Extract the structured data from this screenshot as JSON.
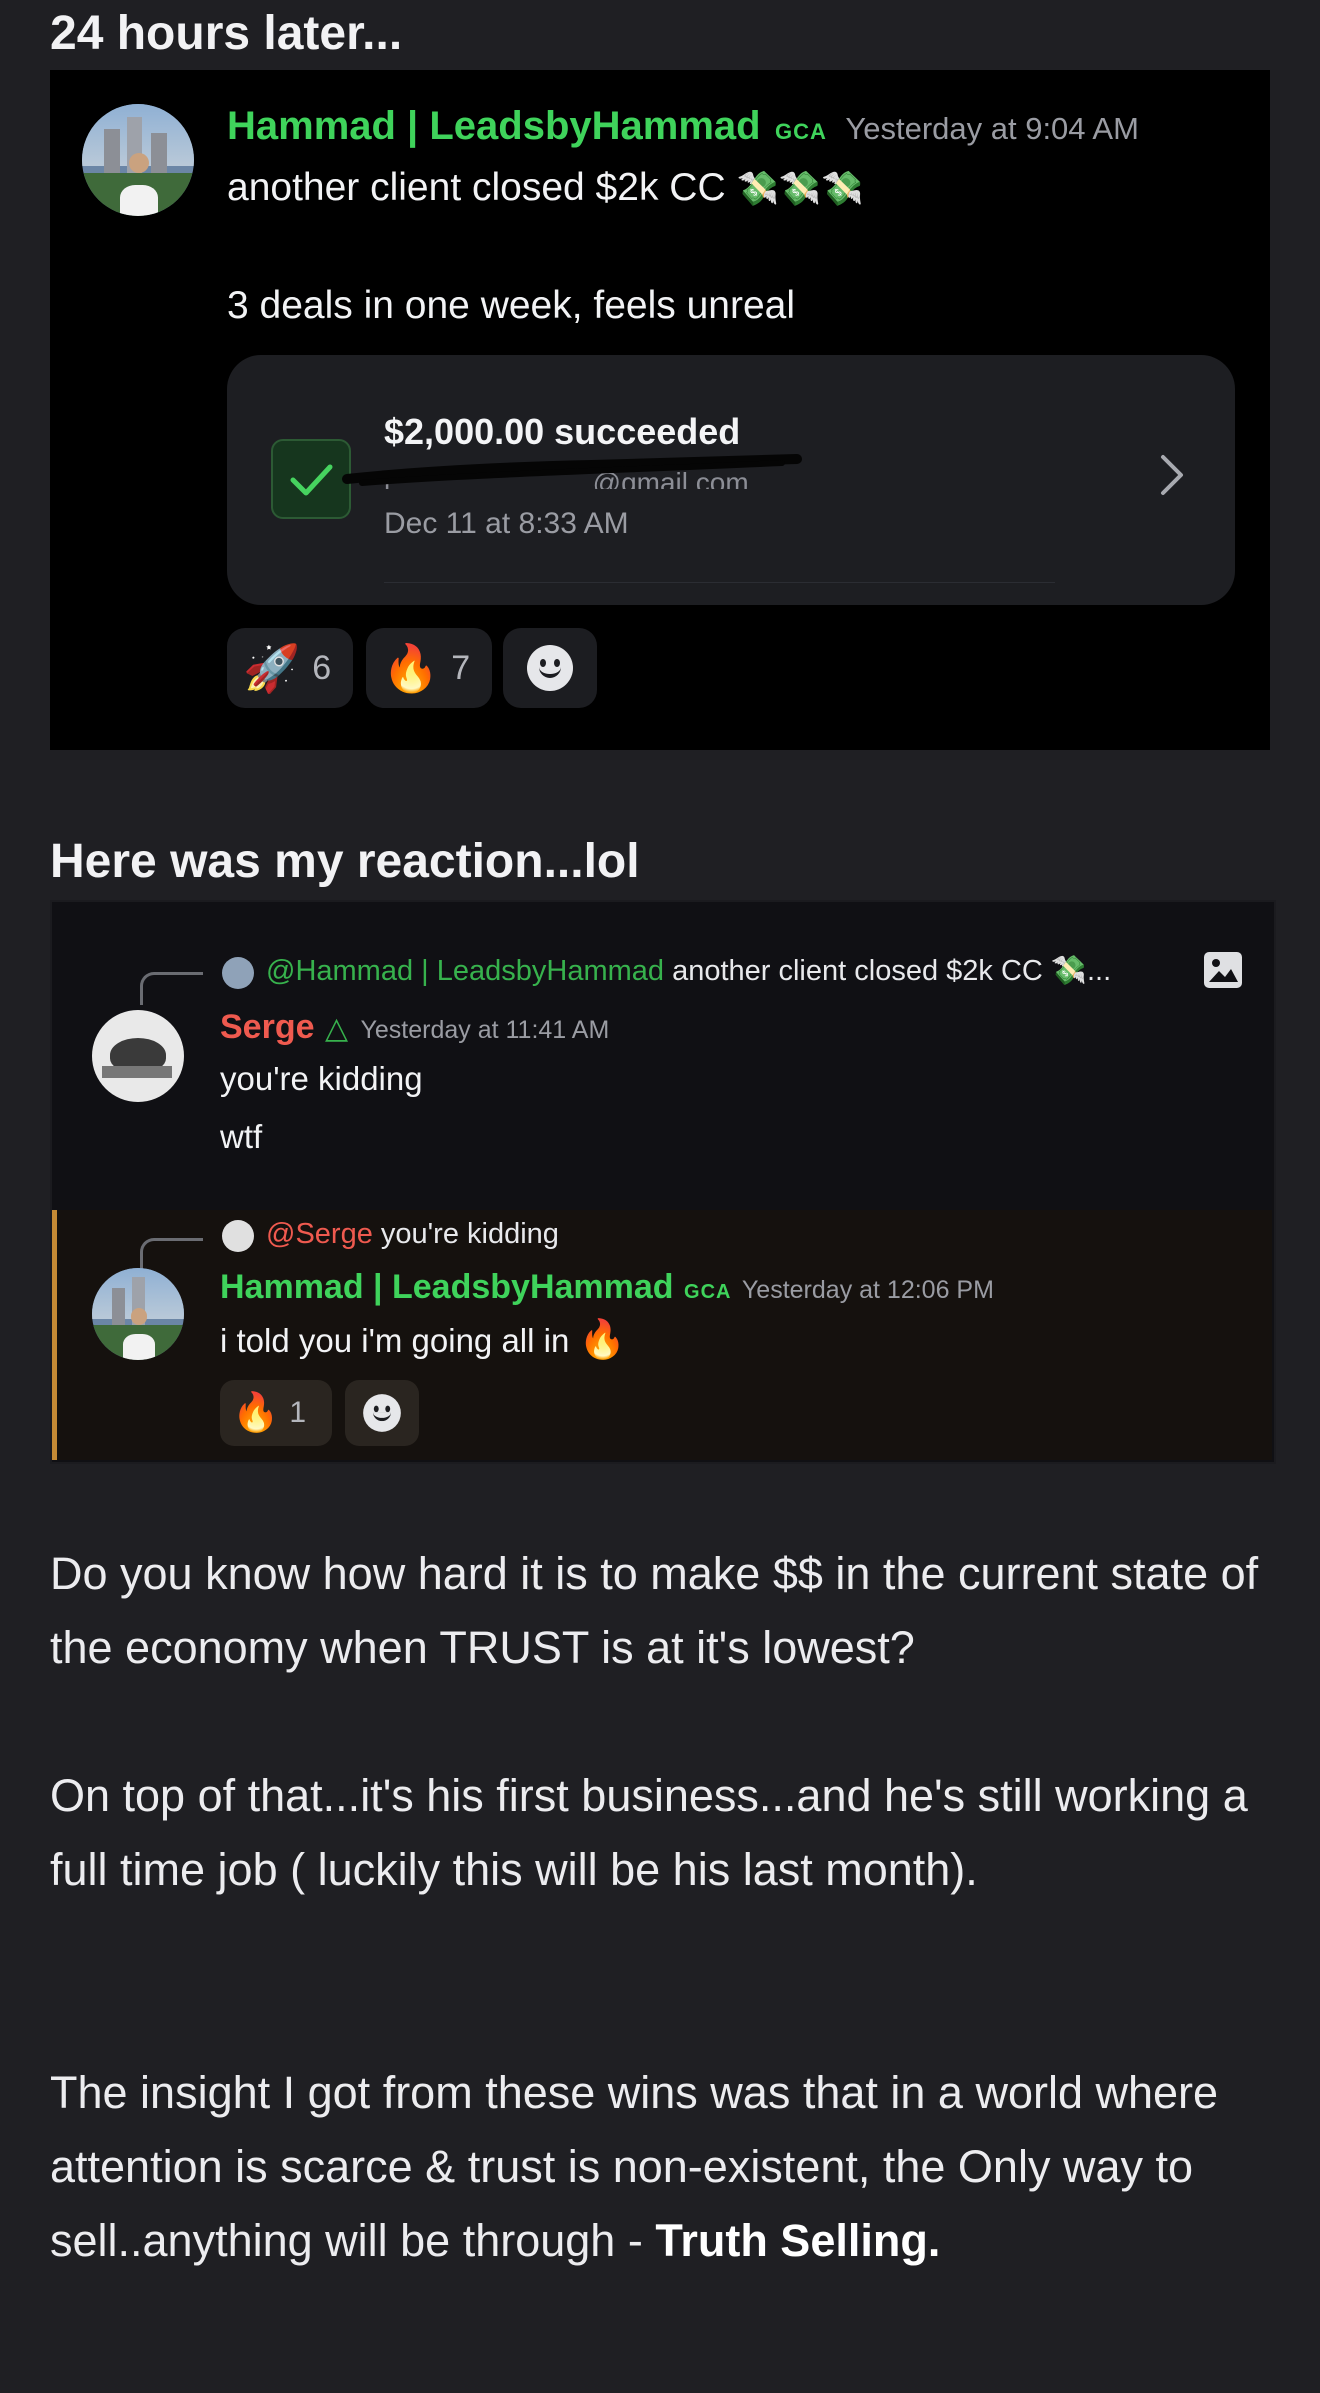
{
  "heading1": "24 hours later...",
  "post1": {
    "author": "Hammad | LeadsbyHammad",
    "tag": "GCA",
    "timestamp": "Yesterday at 9:04 AM",
    "line1": "another client closed $2k CC",
    "line1_emoji": "💸💸💸",
    "line2": "3 deals in one week, feels unreal",
    "payment": {
      "amount": "$2,000.00 succeeded",
      "email_redacted": "i_____________@gmail.com",
      "date": "Dec 11 at 8:33 AM"
    },
    "reactions": [
      {
        "emoji": "🚀",
        "count": "6"
      },
      {
        "emoji": "🔥",
        "count": "7"
      }
    ]
  },
  "heading2": "Here was my reaction...lol",
  "chat": {
    "reply1": {
      "mention": "@Hammad | LeadsbyHammad",
      "text": "another client closed $2k CC 💸..."
    },
    "serge": {
      "name": "Serge",
      "badge_icon": "△",
      "timestamp": "Yesterday at 11:41 AM",
      "line1": "you're kidding",
      "line2": "wtf"
    },
    "reply2": {
      "mention": "@Serge",
      "text": "you're kidding"
    },
    "hammad": {
      "name": "Hammad | LeadsbyHammad",
      "tag": "GCA",
      "timestamp": "Yesterday at 12:06 PM",
      "text": "i told you i'm going all in",
      "emoji": "🔥",
      "reaction": {
        "emoji": "🔥",
        "count": "1"
      }
    }
  },
  "paragraphs": {
    "p1": "Do you know how hard it is to make $$ in the current state of the economy when TRUST is at it's lowest?",
    "p2": "On top of that...it's his first business...and he's still working a full time job ( luckily this will be his last month).",
    "p3_plain": "The insight I got from these wins was that in a world where attention is scarce & trust is non-existent, the Only way to sell..anything will be through - ",
    "p3_bold": "Truth Selling."
  },
  "colors": {
    "background": "#1f1f23",
    "discord_green": "#3fd35b",
    "serge_red": "#ef5a4f",
    "mention_green": "#37b24d",
    "reply_highlight_border": "#c48a35"
  }
}
